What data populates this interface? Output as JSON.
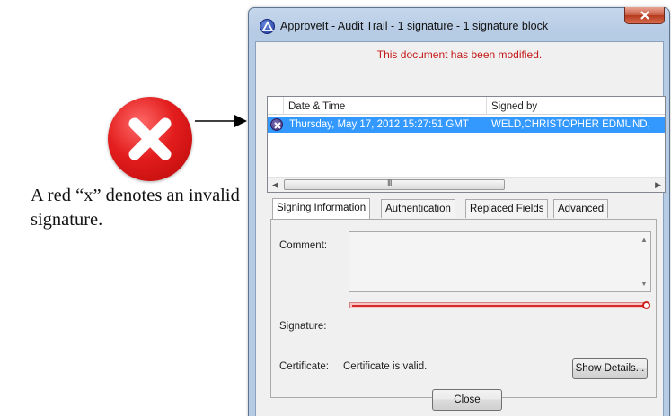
{
  "annotation": {
    "caption": "A red “x” denotes an invalid signature.",
    "icon": "red-x-circle-icon"
  },
  "window": {
    "title": "ApproveIt - Audit Trail - 1 signature - 1 signature block",
    "status_message": "This document has been modified.",
    "status_color": "#c31818"
  },
  "signature_list": {
    "columns": [
      "Date & Time",
      "Signed by"
    ],
    "rows": [
      {
        "status_icon": "invalid-signature-icon",
        "date_time": "Thursday, May 17, 2012 15:27:51 GMT",
        "signed_by": "WELD,CHRISTOPHER EDMUND,"
      }
    ],
    "selected_color": "#3399ff",
    "scroll_grip": "III"
  },
  "tabs": [
    "Signing Information",
    "Authentication",
    "Replaced Fields",
    "Advanced"
  ],
  "signing_info": {
    "comment_label": "Comment:",
    "signature_label": "Signature:",
    "certificate_label": "Certificate:",
    "certificate_value": "Certificate is valid.",
    "show_details_label": "Show Details..."
  },
  "footer": {
    "close_label": "Close"
  }
}
